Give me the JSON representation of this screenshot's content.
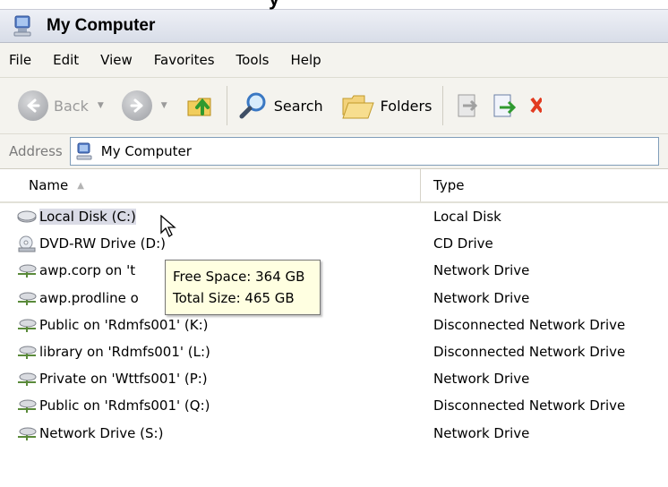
{
  "window": {
    "title": "My Computer"
  },
  "menu": [
    "File",
    "Edit",
    "View",
    "Favorites",
    "Tools",
    "Help"
  ],
  "toolbar": {
    "back_label": "Back",
    "search_label": "Search",
    "folders_label": "Folders"
  },
  "address": {
    "label": "Address",
    "value": "My Computer"
  },
  "columns": {
    "name": "Name",
    "type": "Type"
  },
  "rows": [
    {
      "name": "Local Disk (C:)",
      "type": "Local Disk",
      "icon": "local-disk-icon",
      "selected": true
    },
    {
      "name": "DVD-RW Drive (D:)",
      "type": "CD Drive",
      "icon": "dvd-drive-icon"
    },
    {
      "name": "awp.corp on 't",
      "type": "Network Drive",
      "icon": "network-drive-icon"
    },
    {
      "name": "awp.prodline o",
      "type": "Network Drive",
      "icon": "network-drive-icon"
    },
    {
      "name": "Public on 'Rdmfs001' (K:)",
      "type": "Disconnected Network Drive",
      "icon": "disconnected-drive-icon"
    },
    {
      "name": "library on 'Rdmfs001' (L:)",
      "type": "Disconnected Network Drive",
      "icon": "disconnected-drive-icon"
    },
    {
      "name": "Private on 'Wttfs001' (P:)",
      "type": "Network Drive",
      "icon": "network-drive-icon"
    },
    {
      "name": "Public on 'Rdmfs001' (Q:)",
      "type": "Disconnected Network Drive",
      "icon": "disconnected-drive-icon"
    },
    {
      "name": "Network Drive (S:)",
      "type": "Network Drive",
      "icon": "network-drive-icon"
    }
  ],
  "tooltip": {
    "line1": "Free Space: 364 GB",
    "line2": "Total Size: 465 GB"
  },
  "colors": {
    "selection": "#dadbe6",
    "tooltip_bg": "#ffffe1",
    "toolbar_bg": "#f4f3ee"
  }
}
